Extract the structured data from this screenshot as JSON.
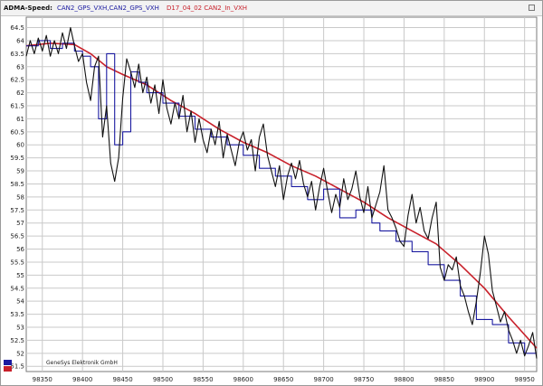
{
  "window": {
    "title": "ADMA-Speed:",
    "channels": [
      {
        "label": "CAN2_GPS_VXH,CAN2_GPS_VXH",
        "color": "#1a1aa0"
      },
      {
        "label": "D17_04_02 CAN2_In_VXH",
        "color": "#c8202a"
      }
    ],
    "copyright": "GeneSys Elektronik GmbH"
  },
  "chart_data": {
    "type": "line",
    "xlim": [
      98330,
      98965
    ],
    "ylim": [
      51.3,
      64.9
    ],
    "x_ticks": [
      98350,
      98400,
      98450,
      98500,
      98550,
      98600,
      98650,
      98700,
      98750,
      98800,
      98850,
      98900,
      98950
    ],
    "y_ticks": [
      51.5,
      52,
      52.5,
      53,
      53.5,
      54,
      54.5,
      55,
      55.5,
      56,
      56.5,
      57,
      57.5,
      58,
      58.5,
      59,
      59.5,
      60,
      60.5,
      61,
      61.5,
      62,
      62.5,
      63,
      63.5,
      64,
      64.5
    ],
    "grid": true,
    "series": [
      {
        "color": "#c8202a",
        "x": [
          98330,
          98360,
          98390,
          98410,
          98430,
          98450,
          98480,
          98510,
          98540,
          98570,
          98600,
          98630,
          98660,
          98690,
          98720,
          98750,
          98780,
          98810,
          98840,
          98870,
          98900,
          98930,
          98965
        ],
        "y": [
          63.8,
          63.9,
          63.85,
          63.5,
          63.0,
          62.7,
          62.3,
          61.7,
          61.2,
          60.6,
          60.1,
          59.7,
          59.2,
          58.8,
          58.3,
          57.8,
          57.2,
          56.7,
          56.2,
          55.4,
          54.5,
          53.4,
          52.2
        ]
      },
      {
        "color": "#1a1aa0",
        "x": [
          98330,
          98345,
          98345,
          98360,
          98360,
          98375,
          98375,
          98390,
          98390,
          98400,
          98400,
          98410,
          98410,
          98420,
          98420,
          98430,
          98430,
          98440,
          98440,
          98450,
          98450,
          98460,
          98460,
          98470,
          98470,
          98480,
          98480,
          98500,
          98500,
          98520,
          98520,
          98540,
          98540,
          98560,
          98560,
          98580,
          98580,
          98600,
          98600,
          98620,
          98620,
          98640,
          98640,
          98660,
          98660,
          98680,
          98680,
          98700,
          98700,
          98720,
          98720,
          98740,
          98740,
          98760,
          98760,
          98770,
          98770,
          98790,
          98790,
          98810,
          98810,
          98830,
          98830,
          98850,
          98850,
          98870,
          98870,
          98890,
          98890,
          98910,
          98910,
          98930,
          98930,
          98950,
          98950,
          98965
        ],
        "y": [
          63.8,
          63.8,
          64.0,
          64.0,
          63.7,
          63.7,
          63.9,
          63.9,
          63.6,
          63.6,
          63.4,
          63.4,
          63.0,
          63.0,
          61.0,
          61.0,
          63.5,
          63.5,
          60.0,
          60.0,
          60.5,
          60.5,
          62.8,
          62.8,
          62.4,
          62.4,
          62.0,
          62.0,
          61.6,
          61.6,
          61.1,
          61.1,
          60.6,
          60.6,
          60.3,
          60.3,
          60.0,
          60.0,
          59.6,
          59.6,
          59.1,
          59.1,
          58.8,
          58.8,
          58.4,
          58.4,
          57.9,
          57.9,
          58.3,
          58.3,
          57.2,
          57.2,
          57.5,
          57.5,
          57.0,
          57.0,
          56.7,
          56.7,
          56.3,
          56.3,
          55.9,
          55.9,
          55.4,
          55.4,
          54.8,
          54.8,
          54.2,
          54.2,
          53.3,
          53.3,
          53.1,
          53.1,
          52.4,
          52.4,
          52.0,
          52.0
        ]
      },
      {
        "color": "#111111",
        "x": [
          98330,
          98335,
          98340,
          98345,
          98350,
          98355,
          98360,
          98365,
          98370,
          98375,
          98380,
          98385,
          98390,
          98395,
          98400,
          98405,
          98410,
          98415,
          98420,
          98425,
          98430,
          98435,
          98440,
          98445,
          98450,
          98455,
          98460,
          98465,
          98470,
          98475,
          98480,
          98485,
          98490,
          98495,
          98500,
          98505,
          98510,
          98515,
          98520,
          98525,
          98530,
          98535,
          98540,
          98545,
          98550,
          98555,
          98560,
          98565,
          98570,
          98575,
          98580,
          98585,
          98590,
          98595,
          98600,
          98605,
          98610,
          98615,
          98620,
          98625,
          98630,
          98635,
          98640,
          98645,
          98650,
          98655,
          98660,
          98665,
          98670,
          98675,
          98680,
          98685,
          98690,
          98695,
          98700,
          98705,
          98710,
          98715,
          98720,
          98725,
          98730,
          98735,
          98740,
          98745,
          98750,
          98755,
          98760,
          98765,
          98770,
          98775,
          98780,
          98785,
          98790,
          98795,
          98800,
          98805,
          98810,
          98815,
          98820,
          98825,
          98830,
          98835,
          98840,
          98845,
          98850,
          98855,
          98860,
          98865,
          98870,
          98875,
          98880,
          98885,
          98890,
          98895,
          98900,
          98905,
          98910,
          98915,
          98920,
          98925,
          98930,
          98935,
          98940,
          98945,
          98950,
          98955,
          98960,
          98965
        ],
        "y": [
          63.4,
          64.0,
          63.5,
          64.1,
          63.6,
          64.2,
          63.4,
          64.0,
          63.5,
          64.3,
          63.7,
          64.5,
          63.8,
          63.2,
          63.5,
          62.4,
          61.7,
          63.0,
          63.4,
          60.3,
          61.5,
          59.3,
          58.6,
          59.5,
          61.8,
          63.3,
          62.8,
          62.2,
          63.1,
          62.0,
          62.6,
          61.6,
          62.3,
          61.2,
          62.5,
          61.4,
          60.8,
          61.6,
          61.0,
          61.9,
          60.5,
          61.3,
          60.1,
          61.0,
          60.2,
          59.7,
          60.6,
          60.0,
          60.9,
          59.5,
          60.4,
          59.8,
          59.2,
          60.1,
          60.5,
          59.8,
          60.2,
          59.0,
          60.3,
          60.8,
          59.6,
          59.0,
          58.4,
          59.2,
          57.9,
          58.8,
          59.3,
          58.7,
          59.4,
          58.5,
          58.0,
          58.6,
          57.5,
          58.4,
          59.1,
          58.2,
          57.4,
          58.1,
          57.6,
          58.7,
          57.9,
          58.3,
          59.0,
          58.0,
          57.4,
          58.4,
          57.2,
          57.7,
          58.2,
          59.2,
          57.5,
          57.2,
          56.8,
          56.3,
          56.1,
          57.3,
          58.1,
          57.0,
          57.6,
          56.7,
          56.4,
          57.2,
          57.8,
          55.3,
          54.8,
          55.4,
          55.2,
          55.7,
          54.6,
          54.2,
          53.6,
          53.1,
          54.0,
          55.1,
          56.5,
          55.8,
          54.4,
          53.8,
          53.2,
          53.6,
          52.9,
          52.5,
          52.0,
          52.5,
          51.9,
          52.3,
          52.8,
          51.8
        ]
      }
    ]
  }
}
